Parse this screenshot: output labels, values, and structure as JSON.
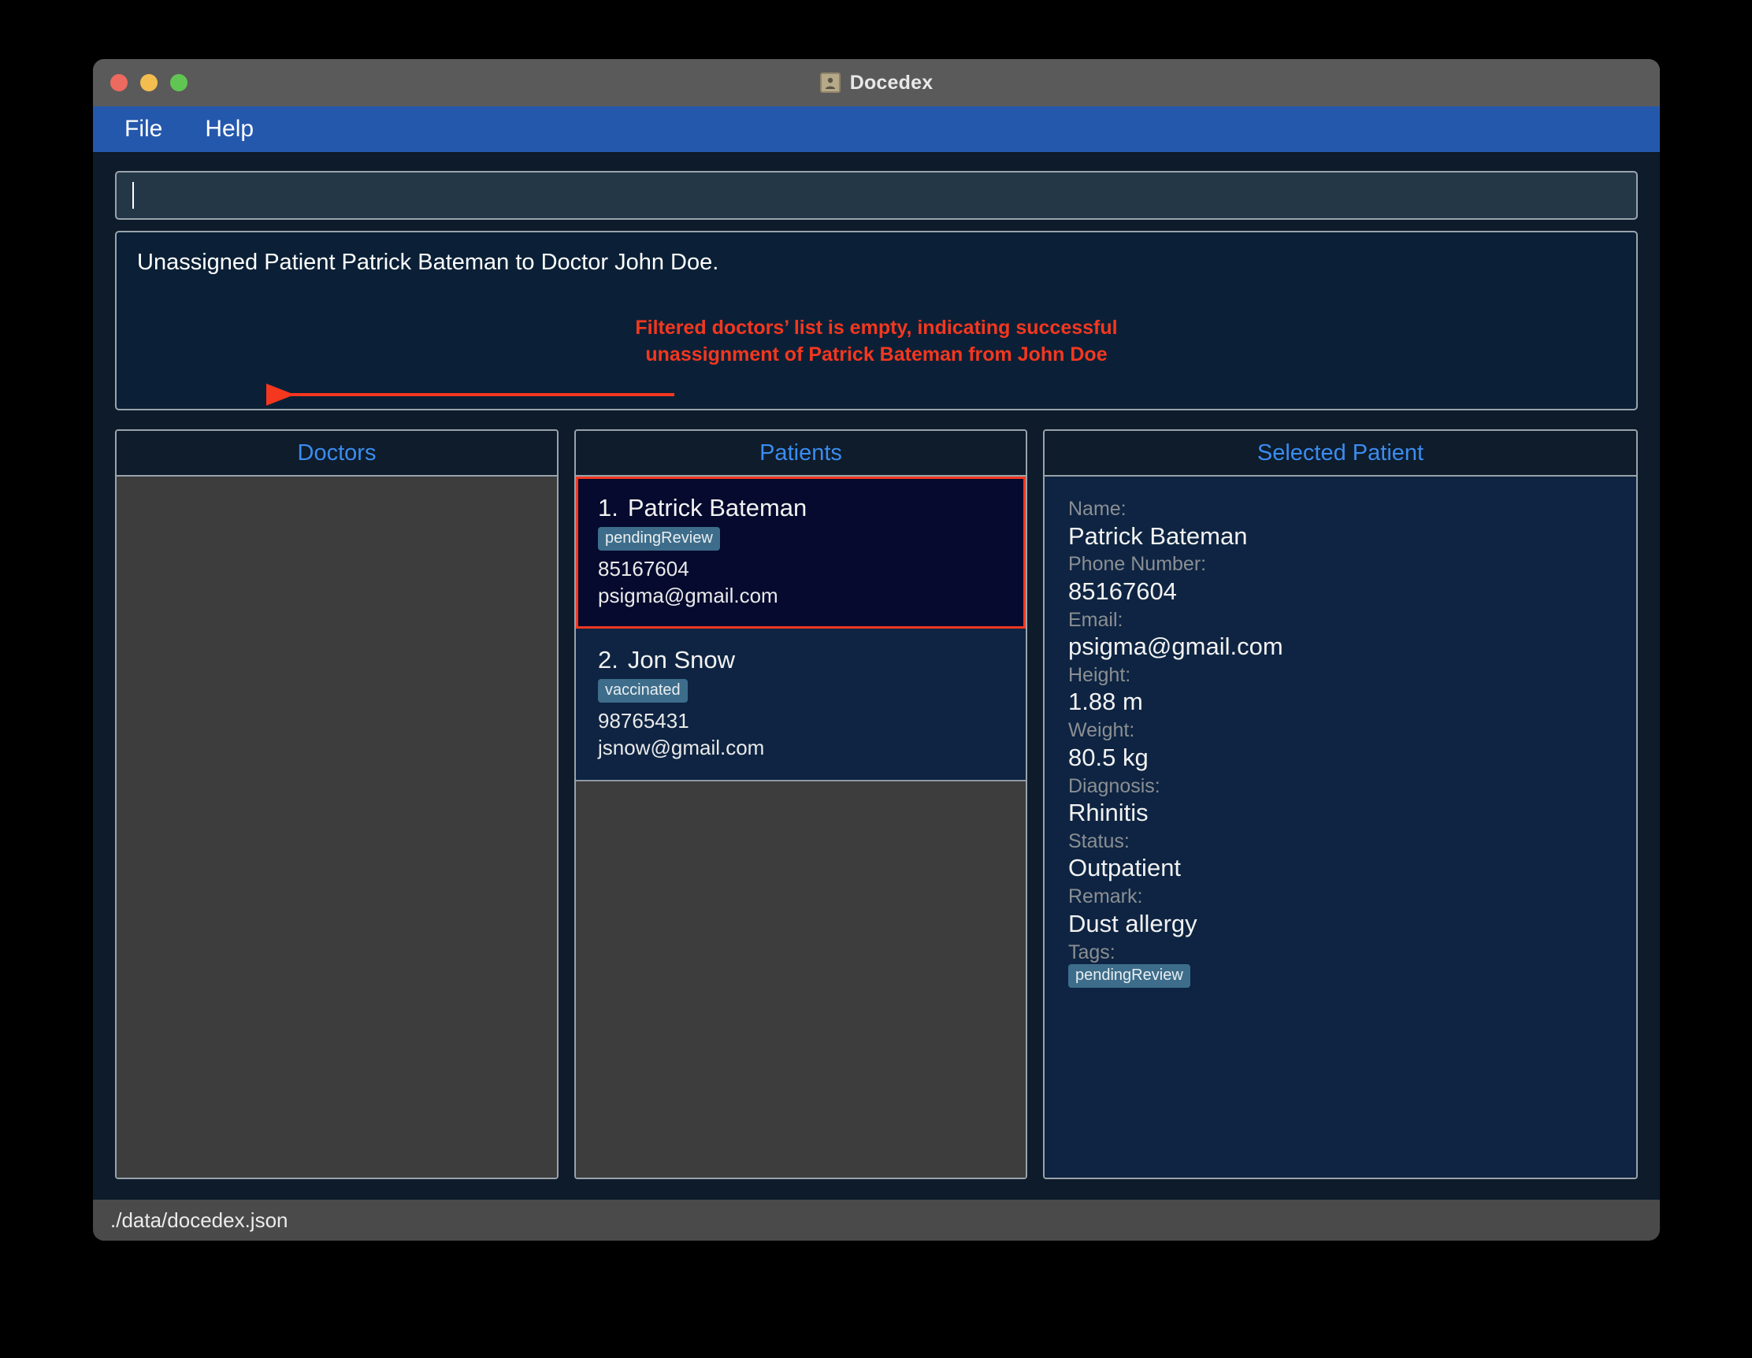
{
  "window": {
    "title": "Docedex",
    "app_icon": "address-book-icon",
    "traffic_lights": [
      "close",
      "minimize",
      "maximize"
    ]
  },
  "menubar": {
    "items": [
      {
        "label": "File"
      },
      {
        "label": "Help"
      }
    ]
  },
  "command_input": {
    "value": "",
    "placeholder": ""
  },
  "result_display": {
    "message": "Unassigned Patient Patrick Bateman to Doctor John Doe.",
    "annotation_line1": "Filtered doctors’ list is empty, indicating successful",
    "annotation_line2": "unassignment of Patrick Bateman from John Doe",
    "annotation_color": "#f4371f"
  },
  "panels": {
    "doctors": {
      "header": "Doctors",
      "items": []
    },
    "patients": {
      "header": "Patients",
      "items": [
        {
          "index": "1.",
          "name": "Patrick Bateman",
          "tag": "pendingReview",
          "phone": "85167604",
          "email": "psigma@gmail.com",
          "selected": true
        },
        {
          "index": "2.",
          "name": "Jon Snow",
          "tag": "vaccinated",
          "phone": "98765431",
          "email": "jsnow@gmail.com",
          "selected": false
        }
      ]
    },
    "selected_patient": {
      "header": "Selected Patient",
      "fields": [
        {
          "label": "Name:",
          "value": "Patrick Bateman"
        },
        {
          "label": "Phone Number:",
          "value": "85167604"
        },
        {
          "label": "Email:",
          "value": "psigma@gmail.com"
        },
        {
          "label": "Height:",
          "value": "1.88 m"
        },
        {
          "label": "Weight:",
          "value": "80.5 kg"
        },
        {
          "label": "Diagnosis:",
          "value": "Rhinitis"
        },
        {
          "label": "Status:",
          "value": "Outpatient"
        },
        {
          "label": "Remark:",
          "value": "Dust allergy"
        }
      ],
      "tags_label": "Tags:",
      "tags": [
        "pendingReview"
      ]
    }
  },
  "statusbar": {
    "file_path": "./data/docedex.json"
  },
  "colors": {
    "accent_blue": "#3b8cf0",
    "menubar_blue": "#2458ad",
    "annotation_red": "#f4371f",
    "tag_teal": "#3d6d8a",
    "panel_navy": "#0e2442",
    "selected_card_navy": "#050a2e",
    "list_gray": "#3d3d3d"
  }
}
